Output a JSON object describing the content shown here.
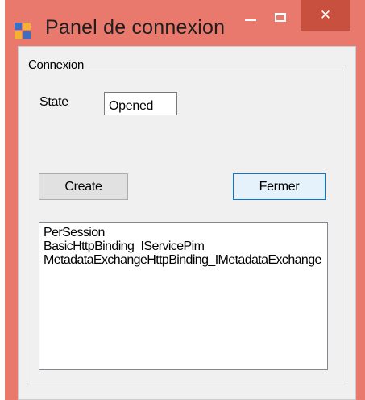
{
  "window": {
    "title": "Panel de connexion",
    "titlebar_color": "#e8796c",
    "app_icon": "app-form-icon",
    "controls": {
      "minimize_icon": "minimize-icon",
      "maximize_icon": "maximize-icon",
      "close_icon": "close-icon",
      "close_glyph": "✕"
    }
  },
  "group": {
    "legend": "Connexion"
  },
  "state": {
    "label": "State",
    "value": "Opened"
  },
  "buttons": {
    "create_label": "Create",
    "fermer_label": "Fermer"
  },
  "bindings_list": {
    "items": [
      "PerSession",
      "BasicHttpBinding_IServicePim",
      "MetadataExchangeHttpBinding_IMetadataExchange"
    ]
  }
}
